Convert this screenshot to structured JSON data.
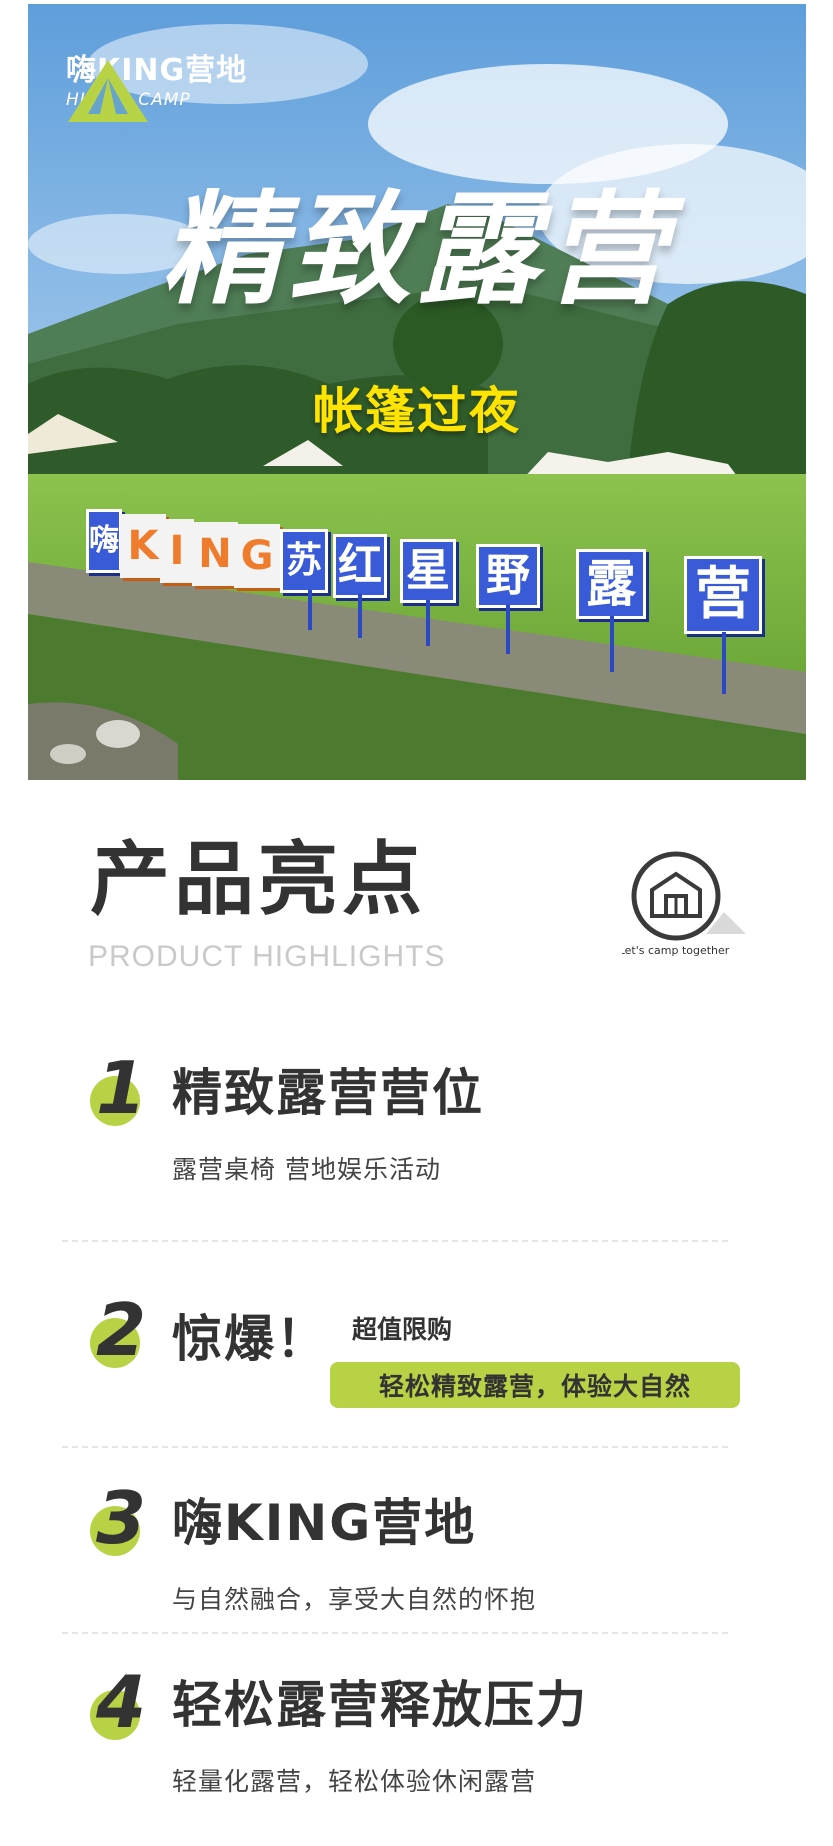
{
  "hero": {
    "logo_cn": "嗨KING营地",
    "logo_en": "HIKING CAMP",
    "title": "精致露营",
    "subtitle": "帐篷过夜",
    "signs": [
      "嗨",
      "K",
      "I",
      "N",
      "G",
      "苏",
      "红",
      "星",
      "野",
      "露",
      "营"
    ]
  },
  "highlights": {
    "title": "产品亮点",
    "subtitle": "PRODUCT HIGHLIGHTS",
    "badge_text": "Let's camp together"
  },
  "items": [
    {
      "number": "1",
      "title": "精致露营营位",
      "desc": "露营桌椅 营地娱乐活动"
    },
    {
      "number": "2",
      "title": "惊爆！",
      "tag": "超值限购",
      "pill": "轻松精致露营，体验大自然"
    },
    {
      "number": "3",
      "title": "嗨KING营地",
      "desc": "与自然融合，享受大自然的怀抱"
    },
    {
      "number": "4",
      "title": "轻松露营释放压力",
      "desc": "轻量化露营，轻松体验休闲露营"
    }
  ],
  "colors": {
    "accent": "#b8d245",
    "text": "#333333",
    "sign_blue": "#3a5bd8",
    "sign_orange": "#ef7c2c",
    "title_yellow": "#ffe400"
  }
}
